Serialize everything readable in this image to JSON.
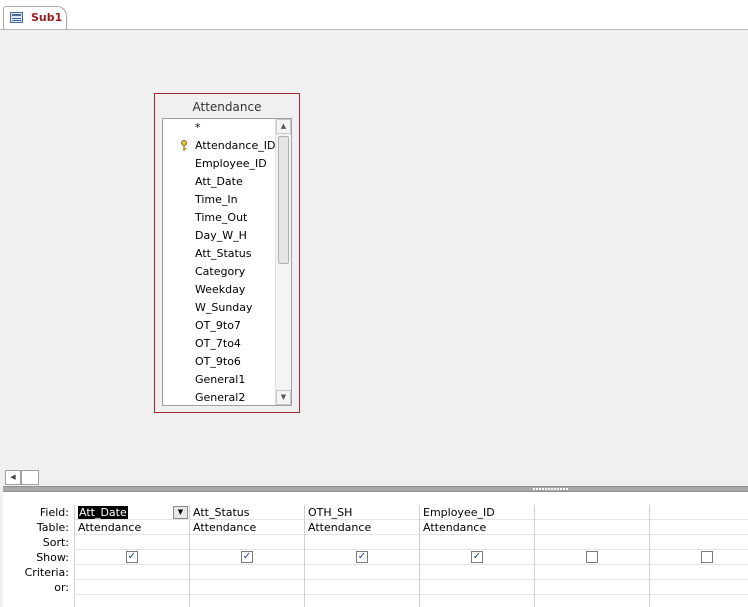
{
  "tab": {
    "label": "Sub1",
    "icon": "query-icon"
  },
  "table": {
    "title": "Attendance",
    "fields": [
      {
        "name": "*",
        "key": false
      },
      {
        "name": "Attendance_ID",
        "key": true
      },
      {
        "name": "Employee_ID",
        "key": false
      },
      {
        "name": "Att_Date",
        "key": false
      },
      {
        "name": "Time_In",
        "key": false
      },
      {
        "name": "Time_Out",
        "key": false
      },
      {
        "name": "Day_W_H",
        "key": false
      },
      {
        "name": "Att_Status",
        "key": false
      },
      {
        "name": "Category",
        "key": false
      },
      {
        "name": "Weekday",
        "key": false
      },
      {
        "name": "W_Sunday",
        "key": false
      },
      {
        "name": "OT_9to7",
        "key": false
      },
      {
        "name": "OT_7to4",
        "key": false
      },
      {
        "name": "OT_9to6",
        "key": false
      },
      {
        "name": "General1",
        "key": false
      },
      {
        "name": "General2",
        "key": false
      }
    ]
  },
  "grid": {
    "row_labels": [
      "Field:",
      "Table:",
      "Sort:",
      "Show:",
      "Criteria:",
      "or:"
    ],
    "columns": [
      {
        "field": "Att_Date",
        "table": "Attendance",
        "sort": "",
        "show": true,
        "selected": true
      },
      {
        "field": "Att_Status",
        "table": "Attendance",
        "sort": "",
        "show": true,
        "selected": false
      },
      {
        "field": "OTH_SH",
        "table": "Attendance",
        "sort": "",
        "show": true,
        "selected": false
      },
      {
        "field": "Employee_ID",
        "table": "Attendance",
        "sort": "",
        "show": true,
        "selected": false
      },
      {
        "field": "",
        "table": "",
        "sort": "",
        "show": false,
        "selected": false
      },
      {
        "field": "",
        "table": "",
        "sort": "",
        "show": false,
        "selected": false
      }
    ]
  },
  "colors": {
    "table_border": "#9b2d30",
    "tab_text": "#a01c1c",
    "check": "#1d3f7a"
  }
}
